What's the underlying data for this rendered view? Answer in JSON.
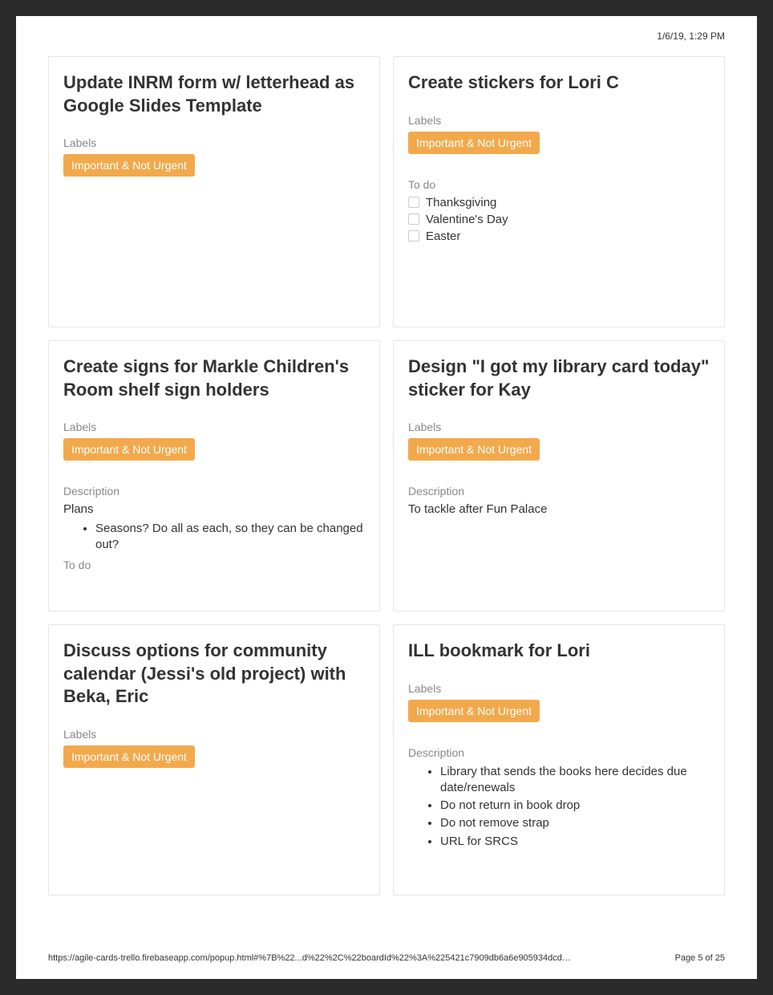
{
  "meta": {
    "timestamp": "1/6/19, 1:29 PM",
    "footer_url": "https://agile-cards-trello.firebaseapp.com/popup.html#%7B%22...d%22%2C%22boardId%22%3A%225421c7909db6a6e905934dcd%22%7D%7D",
    "footer_page": "Page 5 of 25"
  },
  "labels": {
    "labels_heading": "Labels",
    "todo_heading": "To do",
    "description_heading": "Description",
    "chip": "Important & Not Urgent"
  },
  "cards": [
    {
      "title": "Update INRM form w/ letterhead as Google Slides Template",
      "label": "Important & Not Urgent"
    },
    {
      "title": "Create stickers for Lori C",
      "label": "Important & Not Urgent",
      "todo": [
        "Thanksgiving",
        "Valentine's Day",
        "Easter"
      ]
    },
    {
      "title": "Create signs for Markle Children's Room shelf sign holders",
      "label": "Important & Not Urgent",
      "description_lead": "Plans",
      "description_bullets": [
        "Seasons? Do all as each, so they can be changed out?"
      ],
      "trailing_todo_heading": true
    },
    {
      "title": "Design \"I got my library card today\" sticker for Kay",
      "label": "Important & Not Urgent",
      "description_text": "To tackle after Fun Palace"
    },
    {
      "title": "Discuss options for community calendar (Jessi's old project) with Beka, Eric",
      "label": "Important & Not Urgent"
    },
    {
      "title": "ILL bookmark for Lori",
      "label": "Important & Not Urgent",
      "description_bullets": [
        "Library that sends the books here decides due date/renewals",
        "Do not return in book drop",
        "Do not remove strap",
        "URL for SRCS"
      ]
    }
  ]
}
